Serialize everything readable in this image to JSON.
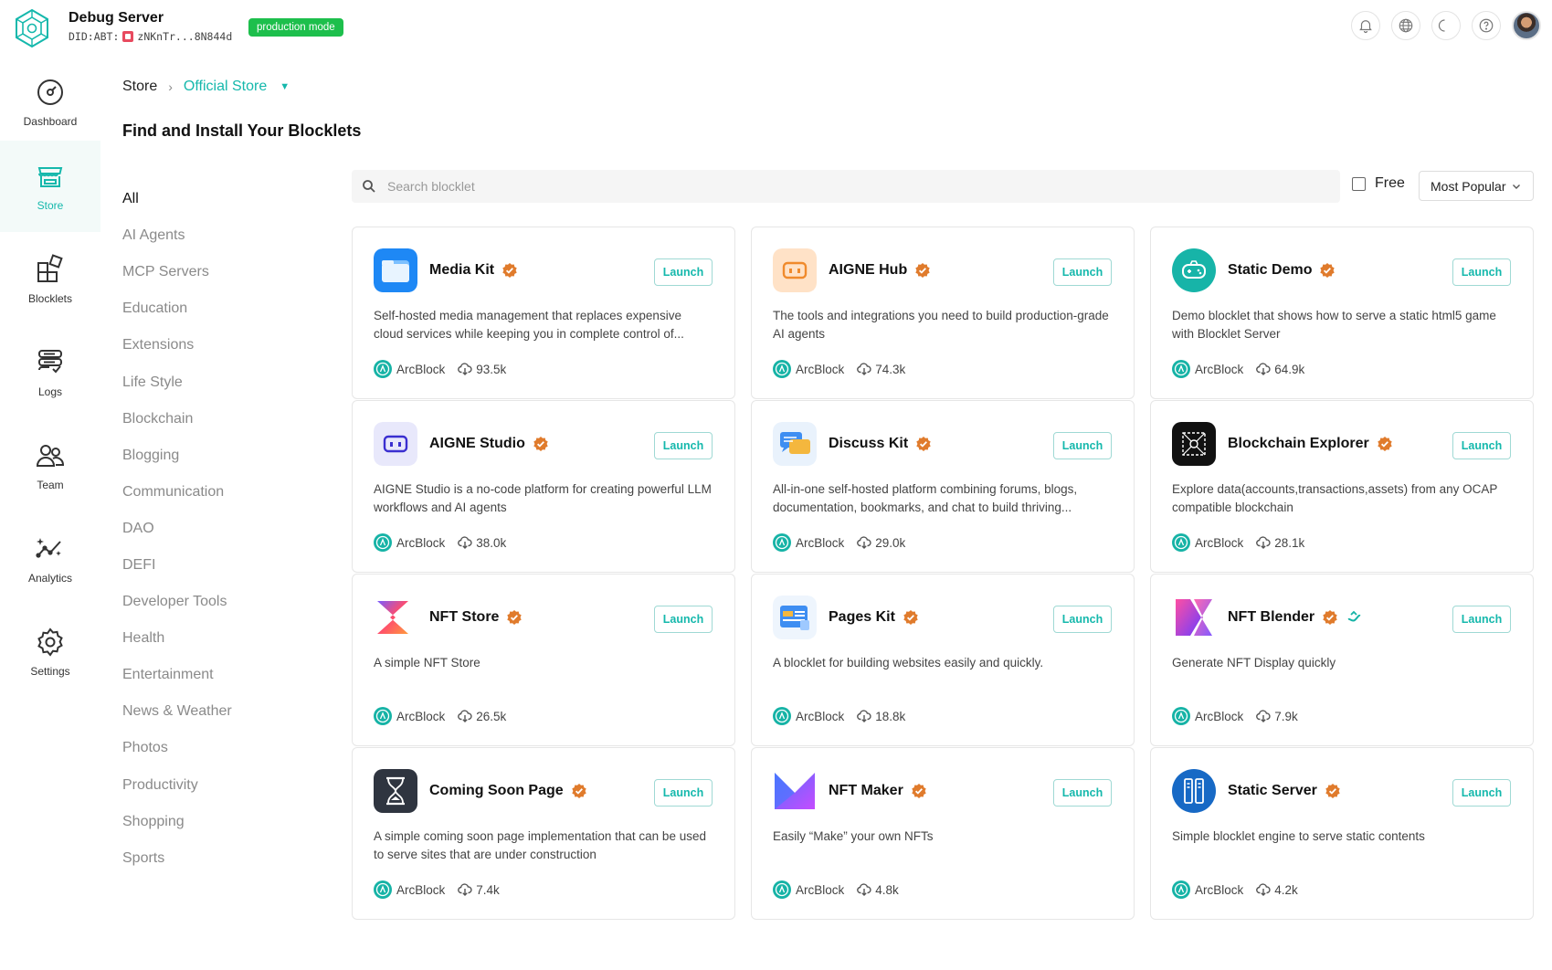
{
  "header": {
    "title": "Debug Server",
    "did_prefix": "DID:ABT:",
    "did_short": "zNKnTr...8N844d",
    "mode_badge": "production mode",
    "icons": [
      "bell-icon",
      "globe-icon",
      "moon-icon",
      "help-icon",
      "user-avatar"
    ]
  },
  "nav": {
    "items": [
      {
        "label": "Dashboard",
        "icon": "dashboard-icon"
      },
      {
        "label": "Store",
        "icon": "store-icon",
        "active": true
      },
      {
        "label": "Blocklets",
        "icon": "blocklets-icon"
      },
      {
        "label": "Logs",
        "icon": "logs-icon"
      },
      {
        "label": "Team",
        "icon": "team-icon"
      },
      {
        "label": "Analytics",
        "icon": "analytics-icon"
      },
      {
        "label": "Settings",
        "icon": "settings-icon"
      }
    ]
  },
  "breadcrumb": {
    "root": "Store",
    "sep": "›",
    "current": "Official Store"
  },
  "page_title": "Find and Install Your Blocklets",
  "categories": [
    "All",
    "AI Agents",
    "MCP Servers",
    "Education",
    "Extensions",
    "Life Style",
    "Blockchain",
    "Blogging",
    "Communication",
    "DAO",
    "DEFI",
    "Developer Tools",
    "Health",
    "Entertainment",
    "News & Weather",
    "Photos",
    "Productivity",
    "Shopping",
    "Sports"
  ],
  "active_category": "All",
  "search": {
    "placeholder": "Search blocklet",
    "value": ""
  },
  "filter": {
    "free_label": "Free",
    "free_checked": false
  },
  "sort": {
    "selected": "Most Popular"
  },
  "colors": {
    "accent": "#15b8ac",
    "badge_green": "#1dbf4c",
    "verified_orange": "#e07b2c"
  },
  "cards": [
    {
      "name": "Media Kit",
      "desc": "Self-hosted media management that replaces expensive cloud services while keeping you in complete control of...",
      "author": "ArcBlock",
      "downloads": "93.5k",
      "launch": "Launch",
      "icon": "media-kit-icon"
    },
    {
      "name": "AIGNE Hub",
      "desc": "The tools and integrations you need to build production-grade AI agents",
      "author": "ArcBlock",
      "downloads": "74.3k",
      "launch": "Launch",
      "icon": "aigne-hub-icon"
    },
    {
      "name": "Static Demo",
      "desc": "Demo blocklet that shows how to serve a static html5 game with Blocklet Server",
      "author": "ArcBlock",
      "downloads": "64.9k",
      "launch": "Launch",
      "icon": "static-demo-icon"
    },
    {
      "name": "AIGNE Studio",
      "desc": "AIGNE Studio is a no-code platform for creating powerful LLM workflows and AI agents",
      "author": "ArcBlock",
      "downloads": "38.0k",
      "launch": "Launch",
      "icon": "aigne-studio-icon"
    },
    {
      "name": "Discuss Kit",
      "desc": "All-in-one self-hosted platform combining forums, blogs, documentation, bookmarks, and chat to build thriving...",
      "author": "ArcBlock",
      "downloads": "29.0k",
      "launch": "Launch",
      "icon": "discuss-kit-icon"
    },
    {
      "name": "Blockchain Explorer",
      "desc": "Explore data(accounts,transactions,assets) from any OCAP compatible blockchain",
      "author": "ArcBlock",
      "downloads": "28.1k",
      "launch": "Launch",
      "icon": "blockchain-explorer-icon"
    },
    {
      "name": "NFT Store",
      "desc": "A simple NFT Store",
      "author": "ArcBlock",
      "downloads": "26.5k",
      "launch": "Launch",
      "icon": "nft-store-icon"
    },
    {
      "name": "Pages Kit",
      "desc": "A blocklet for building websites easily and quickly.",
      "author": "ArcBlock",
      "downloads": "18.8k",
      "launch": "Launch",
      "icon": "pages-kit-icon"
    },
    {
      "name": "NFT Blender",
      "desc": "Generate NFT Display quickly",
      "author": "ArcBlock",
      "downloads": "7.9k",
      "launch": "Launch",
      "icon": "nft-blender-icon",
      "extra_badge": "crypto-badge-icon"
    },
    {
      "name": "Coming Soon Page",
      "desc": "A simple coming soon page implementation that can be used to serve sites that are under construction",
      "author": "ArcBlock",
      "downloads": "7.4k",
      "launch": "Launch",
      "icon": "coming-soon-icon"
    },
    {
      "name": "NFT Maker",
      "desc": "Easily “Make” your own NFTs",
      "author": "ArcBlock",
      "downloads": "4.8k",
      "launch": "Launch",
      "icon": "nft-maker-icon"
    },
    {
      "name": "Static Server",
      "desc": "Simple blocklet engine to serve static contents",
      "author": "ArcBlock",
      "downloads": "4.2k",
      "launch": "Launch",
      "icon": "static-server-icon"
    }
  ]
}
